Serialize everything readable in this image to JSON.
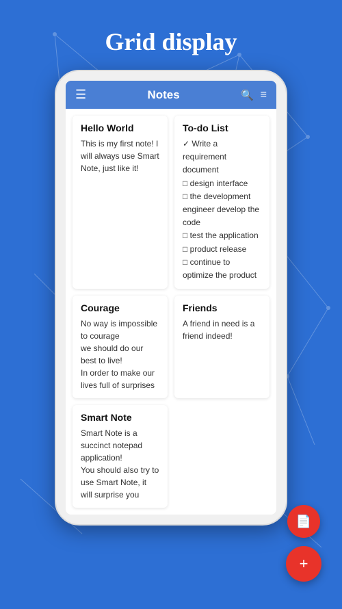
{
  "page": {
    "title": "Grid display",
    "background_color": "#2d6fd4"
  },
  "topbar": {
    "title": "Notes",
    "menu_icon": "☰",
    "search_icon": "🔍",
    "filter_icon": "☰"
  },
  "notes": [
    {
      "id": "note-hello-world",
      "title": "Hello World",
      "content": "This is my first note! I will always use Smart Note, just like it!",
      "type": "text"
    },
    {
      "id": "note-todo",
      "title": "To-do List",
      "type": "checklist",
      "items": [
        {
          "checked": true,
          "text": "Write a requirement document"
        },
        {
          "checked": false,
          "text": "design interface"
        },
        {
          "checked": false,
          "text": "the development engineer develop the code"
        },
        {
          "checked": false,
          "text": "test the application"
        },
        {
          "checked": false,
          "text": "product release"
        },
        {
          "checked": false,
          "text": "continue to optimize the product"
        }
      ]
    },
    {
      "id": "note-courage",
      "title": "Courage",
      "content": "No way is impossible to courage\nwe should do our best to live!\nIn order to make our lives full of surprises",
      "type": "text"
    },
    {
      "id": "note-friends",
      "title": "Friends",
      "content": "A friend in need is a friend indeed!",
      "type": "text"
    },
    {
      "id": "note-smart-note",
      "title": "Smart Note",
      "content": "Smart Note is a succinct notepad application!\nYou should also try to use Smart Note, it will surprise you",
      "type": "text"
    }
  ],
  "fab": {
    "document_icon": "📄",
    "add_icon": "+"
  }
}
